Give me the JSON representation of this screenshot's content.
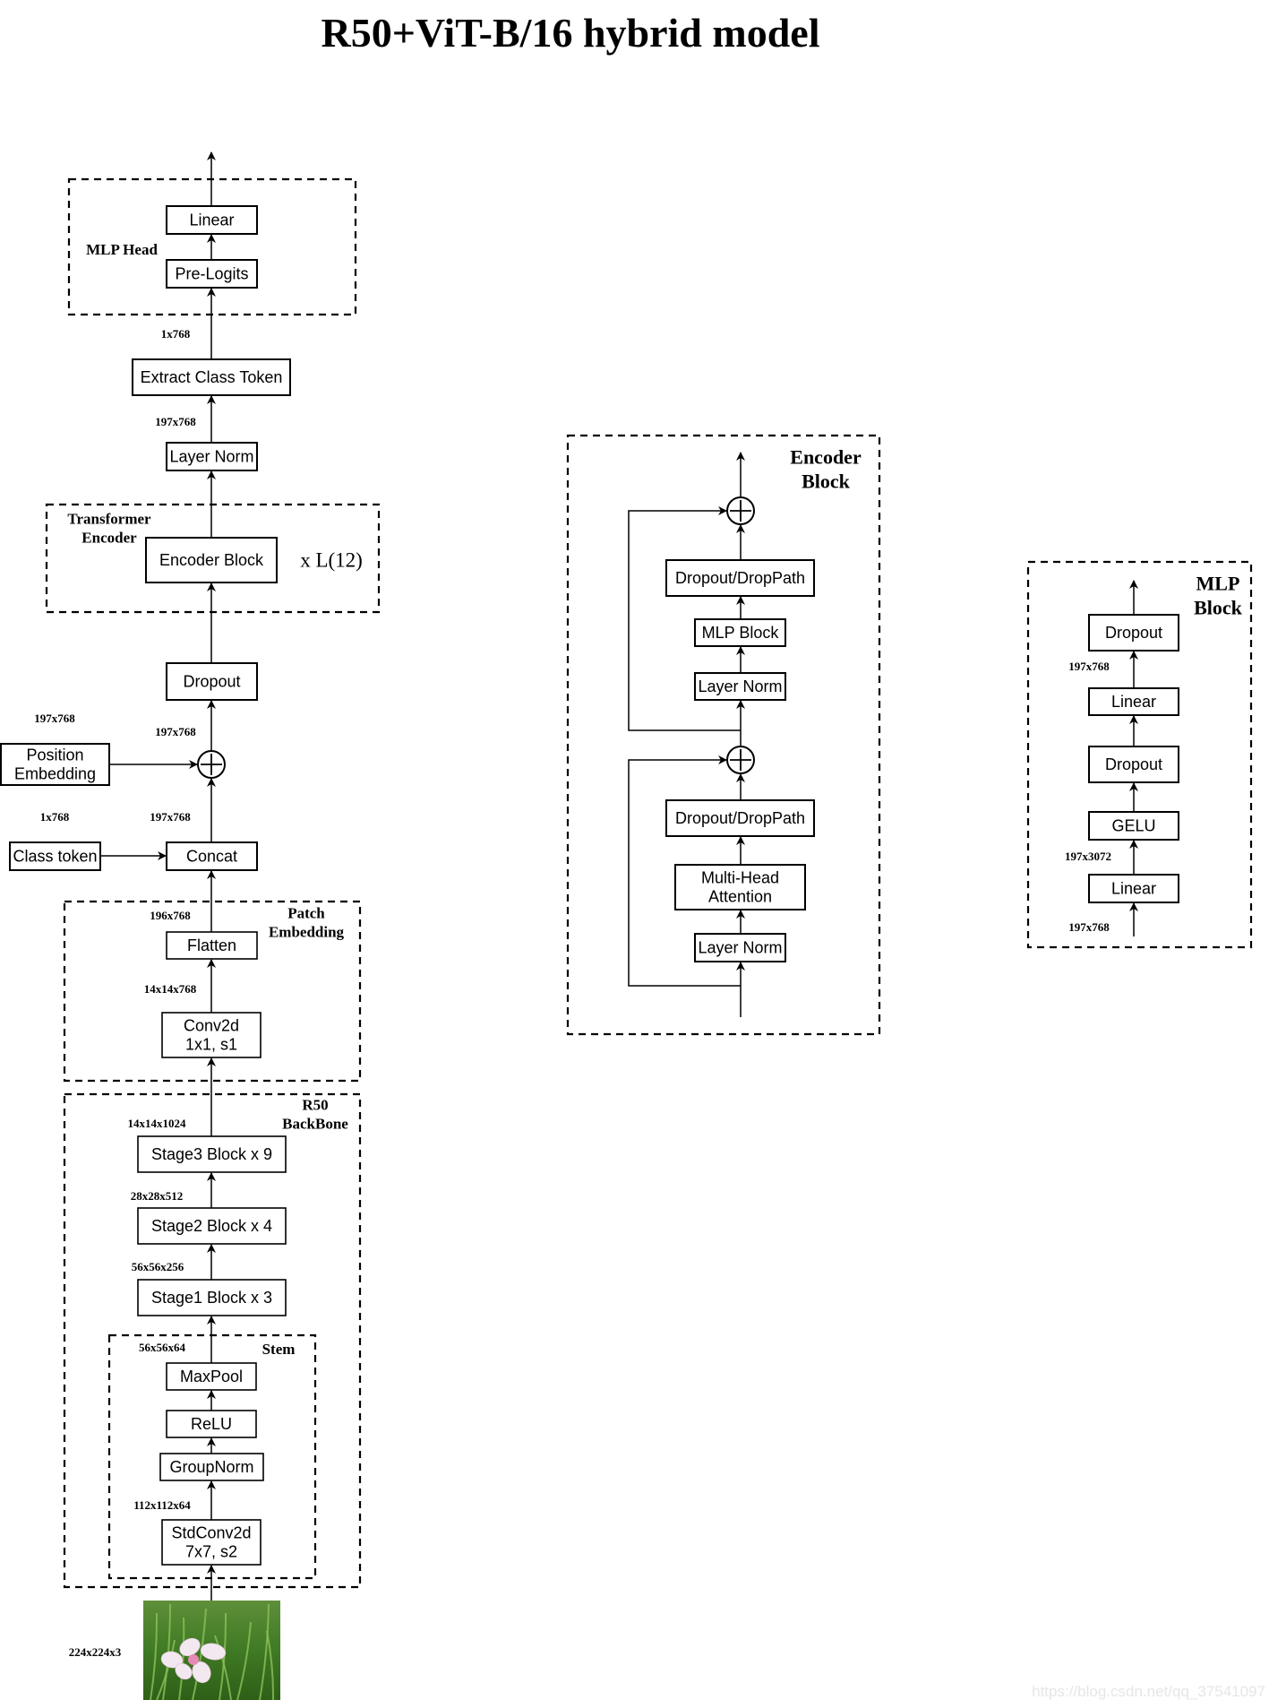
{
  "title": "R50+ViT-B/16 hybrid model",
  "watermark": "https://blog.csdn.net/qq_37541097",
  "main_model": {
    "groups": {
      "mlp_head": "MLP Head",
      "transformer_encoder": [
        "Transformer",
        "Encoder"
      ],
      "patch_embedding": [
        "Patch",
        "Embedding"
      ],
      "r50_backbone": [
        "R50",
        "BackBone"
      ],
      "stem": "Stem"
    },
    "nodes": {
      "linear": "Linear",
      "pre_logits": "Pre-Logits",
      "extract_class_token": "Extract Class Token",
      "layer_norm": "Layer Norm",
      "encoder_block": "Encoder Block",
      "encoder_repeat": "x L(12)",
      "dropout": "Dropout",
      "position_embedding": [
        "Position",
        "Embedding"
      ],
      "class_token": "Class token",
      "concat": "Concat",
      "flatten": "Flatten",
      "conv2d": [
        "Conv2d",
        "1x1, s1"
      ],
      "stage3": "Stage3 Block x 9",
      "stage2": "Stage2 Block x 4",
      "stage1": "Stage1 Block x 3",
      "maxpool": "MaxPool",
      "relu": "ReLU",
      "groupnorm": "GroupNorm",
      "stdconv2d": [
        "StdConv2d",
        "7x7, s2"
      ]
    },
    "dims": {
      "after_extract": "1x768",
      "after_layernorm": "197x768",
      "pos_embed": "197x768",
      "after_add": "197x768",
      "class_token": "1x768",
      "after_concat": "197x768",
      "after_flatten": "196x768",
      "after_conv": "14x14x768",
      "stage3_out": "14x14x1024",
      "stage2_out": "28x28x512",
      "stage1_out": "56x56x256",
      "stem_out": "56x56x64",
      "stdconv_out": "112x112x64",
      "input": "224x224x3"
    },
    "input_image": "flower-in-grass-photo"
  },
  "encoder_block": {
    "title": [
      "Encoder",
      "Block"
    ],
    "nodes": {
      "dropout_top": "Dropout/DropPath",
      "mlp_block": "MLP Block",
      "layer_norm_top": "Layer Norm",
      "dropout_bottom": "Dropout/DropPath",
      "mha": [
        "Multi-Head",
        "Attention"
      ],
      "layer_norm_bottom": "Layer Norm"
    }
  },
  "mlp_block": {
    "title": [
      "MLP",
      "Block"
    ],
    "nodes": {
      "dropout_top": "Dropout",
      "linear_top": "Linear",
      "dropout_mid": "Dropout",
      "gelu": "GELU",
      "linear_bottom": "Linear"
    },
    "dims": {
      "after_linear_top": "197x768",
      "after_linear_bottom": "197x3072",
      "input": "197x768"
    }
  }
}
